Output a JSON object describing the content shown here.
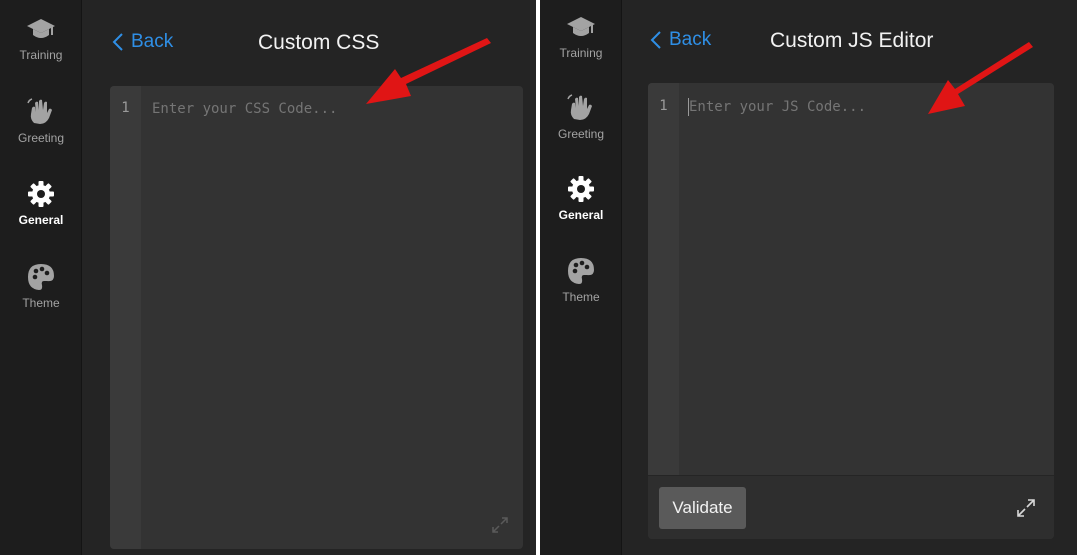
{
  "colors": {
    "panel_bg": "#242424",
    "sidebar_bg": "#1d1d1d",
    "editor_bg": "#333333",
    "accent_blue": "#2f8fe6",
    "annotation_red": "#e01515"
  },
  "sidebar": {
    "items": [
      {
        "label": "Training",
        "icon": "graduation-cap-icon",
        "active": false
      },
      {
        "label": "Greeting",
        "icon": "waving-hand-icon",
        "active": false
      },
      {
        "label": "General",
        "icon": "gear-icon",
        "active": true
      },
      {
        "label": "Theme",
        "icon": "palette-icon",
        "active": false
      }
    ]
  },
  "left": {
    "back_label": "Back",
    "title": "Custom CSS",
    "editor": {
      "line_number": "1",
      "placeholder": "Enter your CSS Code..."
    }
  },
  "right": {
    "back_label": "Back",
    "title": "Custom JS Editor",
    "editor": {
      "line_number": "1",
      "placeholder": "Enter your JS Code..."
    },
    "validate_label": "Validate"
  }
}
